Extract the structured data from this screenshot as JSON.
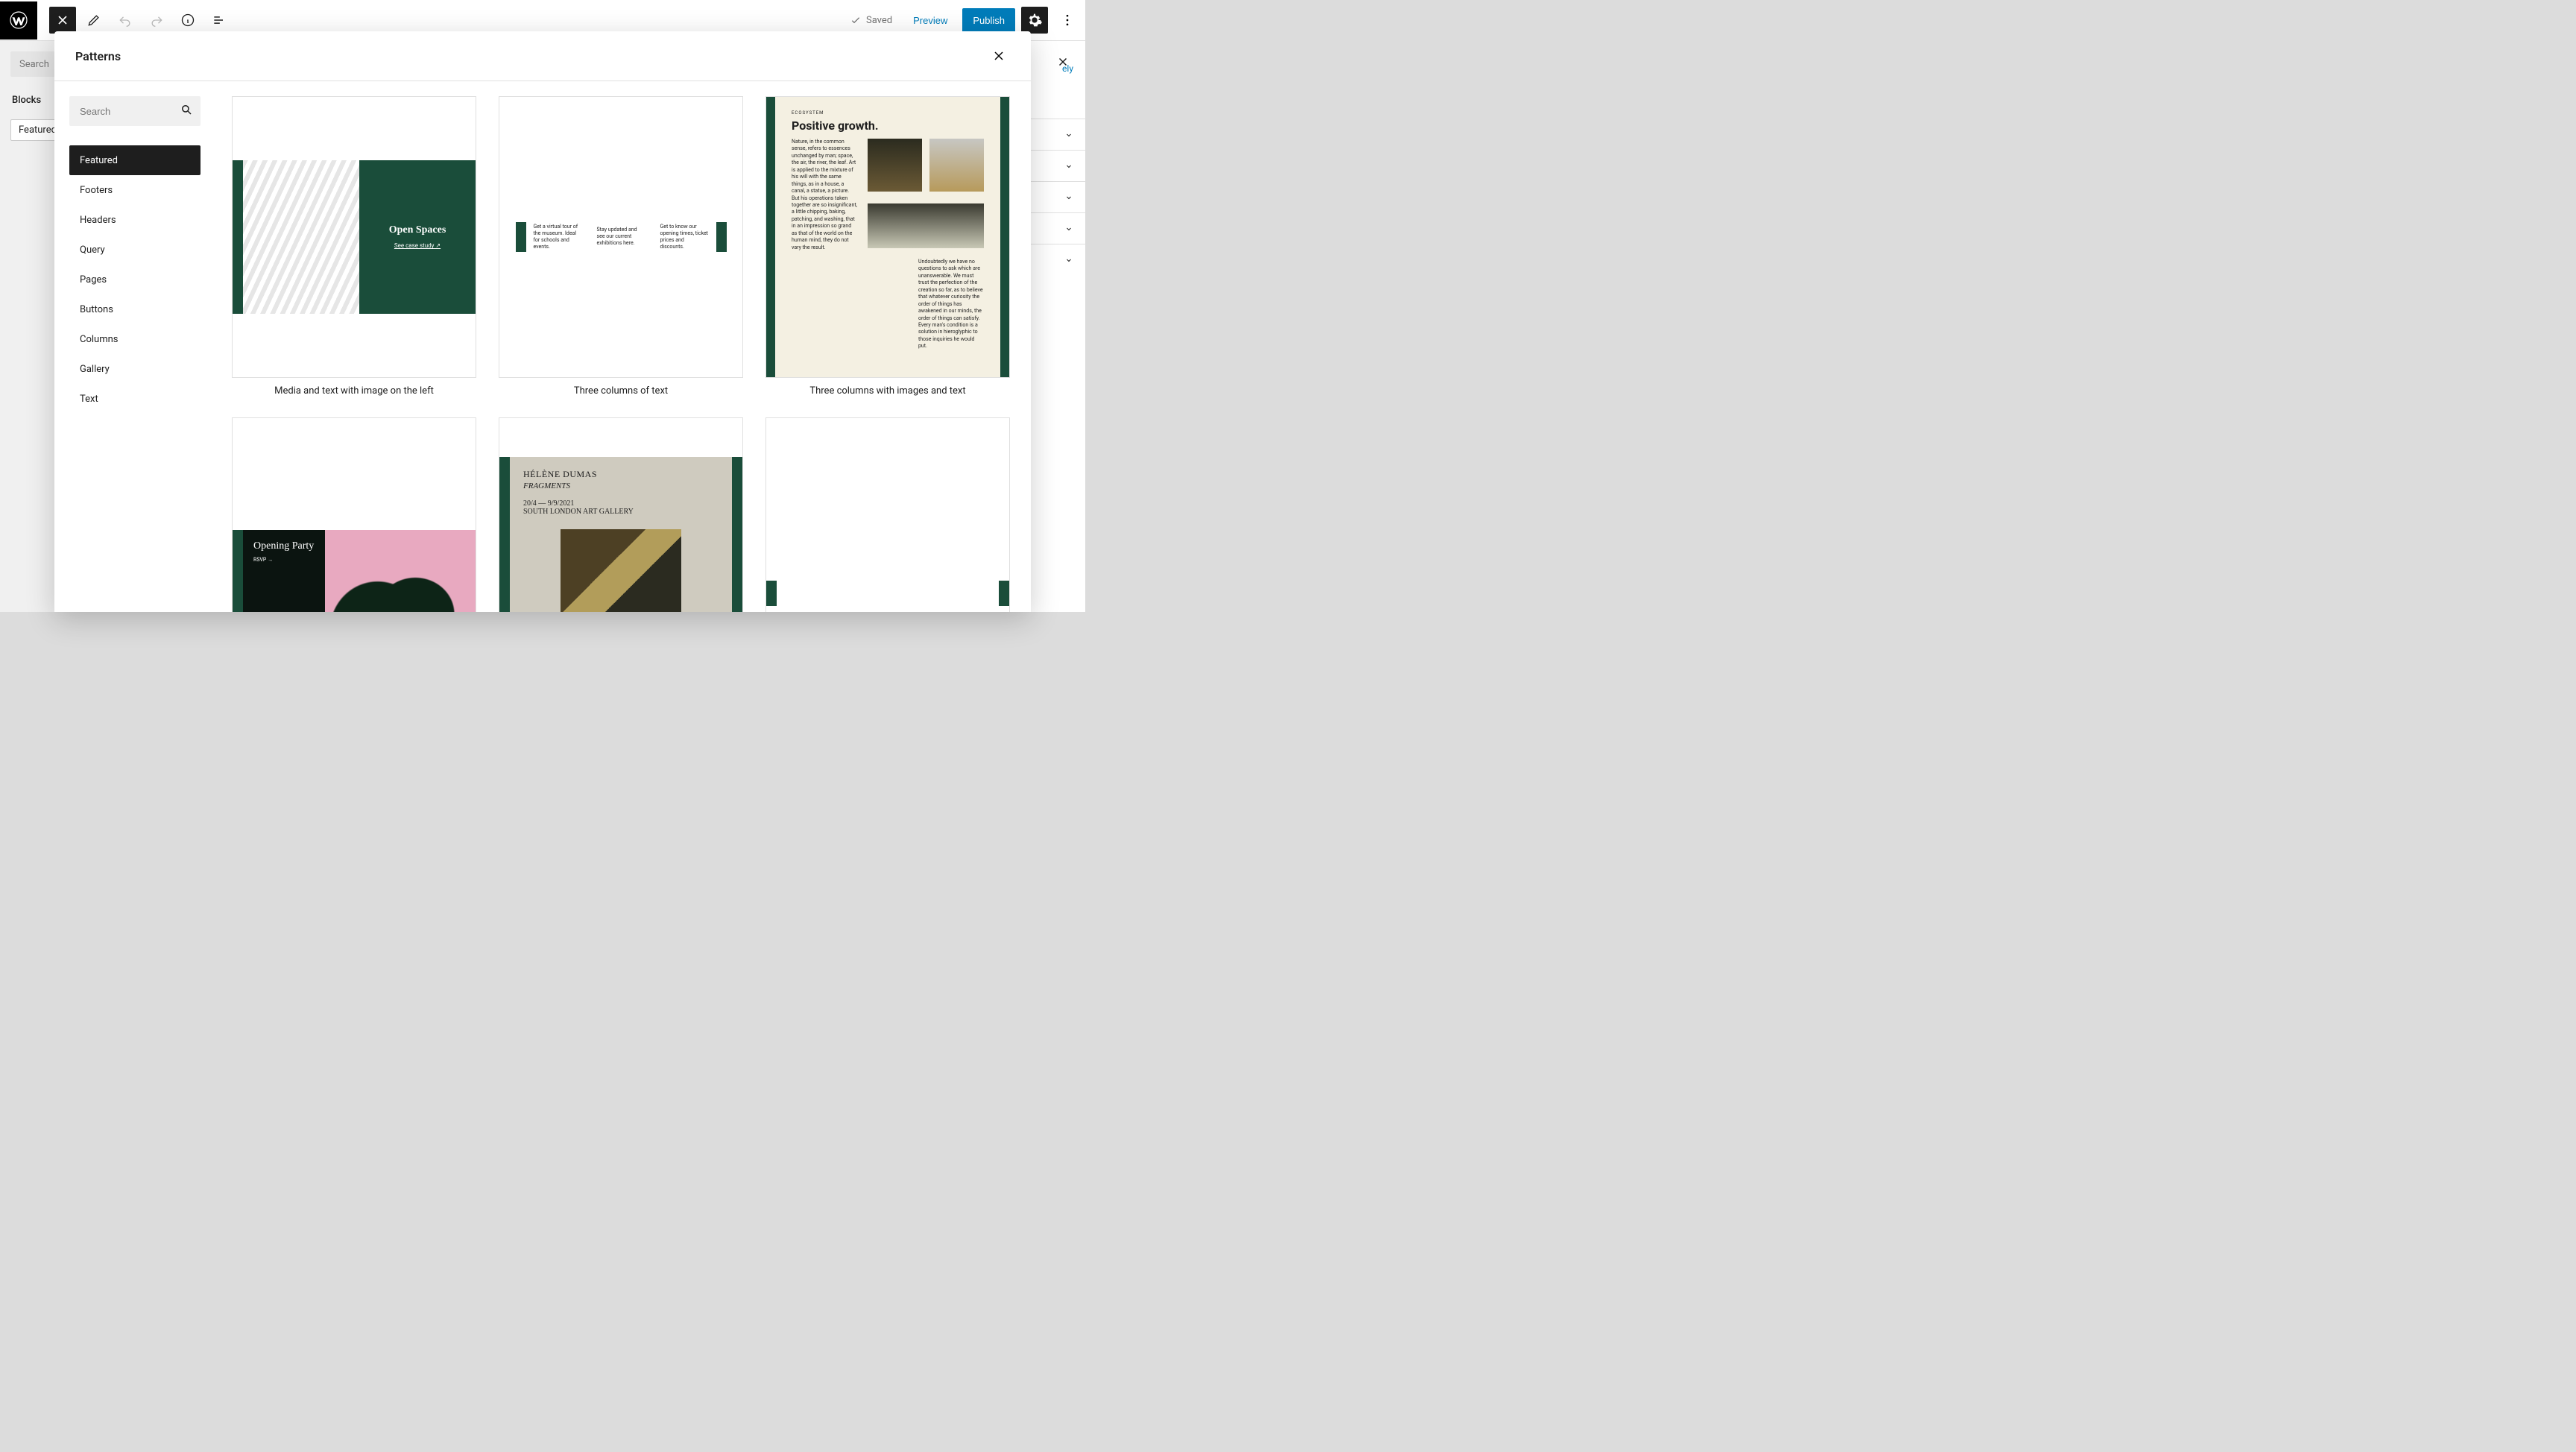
{
  "toolbar": {
    "saved": "Saved",
    "preview": "Preview",
    "publish": "Publish"
  },
  "left_panel": {
    "search_placeholder": "Search",
    "blocks_heading": "Blocks",
    "featured_tag": "Featured"
  },
  "right_panel": {
    "link_text_partial": "ely"
  },
  "modal": {
    "title": "Patterns",
    "search_placeholder": "Search",
    "categories": [
      "Featured",
      "Footers",
      "Headers",
      "Query",
      "Pages",
      "Buttons",
      "Columns",
      "Gallery",
      "Text"
    ],
    "patterns": [
      {
        "caption": "Media and text with image on the left",
        "pv1_heading": "Open Spaces",
        "pv1_link": "See case study ↗"
      },
      {
        "caption": "Three columns of text",
        "pv2_col1": "Get a virtual tour of the museum. Ideal for schools and events.",
        "pv2_col2": "Stay updated and see our current exhibitions here.",
        "pv2_col3": "Get to know our opening times, ticket prices and discounts."
      },
      {
        "caption": "Three columns with images and text",
        "pv3_eyebrow": "ECOSYSTEM",
        "pv3_heading": "Positive growth.",
        "pv3_body1": "Nature, in the common sense, refers to essences unchanged by man; space, the air, the river, the leaf. Art is applied to the mixture of his will with the same things, as in a house, a canal, a statue, a picture. But his operations taken together are so insignificant, a little chipping, baking, patching, and washing, that in an impression so grand as that of the world on the human mind, they do not vary the result.",
        "pv3_body2": "Undoubtedly we have no questions to ask which are unanswerable. We must trust the perfection of the creation so far, as to believe that whatever curiosity the order of things has awakened in our minds, the order of things can satisfy. Every man's condition is a solution in hieroglyphic to those inquiries he would put."
      },
      {
        "caption": "",
        "pv4_heading": "Opening Party",
        "pv4_link": "RSVP →"
      },
      {
        "caption": "",
        "pv5_l1": "HÉLÈNE DUMAS",
        "pv5_l2": "FRAGMENTS",
        "pv5_l3": "20/4 — 9/9/2021",
        "pv5_l4": "SOUTH LONDON ART GALLERY"
      },
      {
        "caption": ""
      }
    ]
  }
}
